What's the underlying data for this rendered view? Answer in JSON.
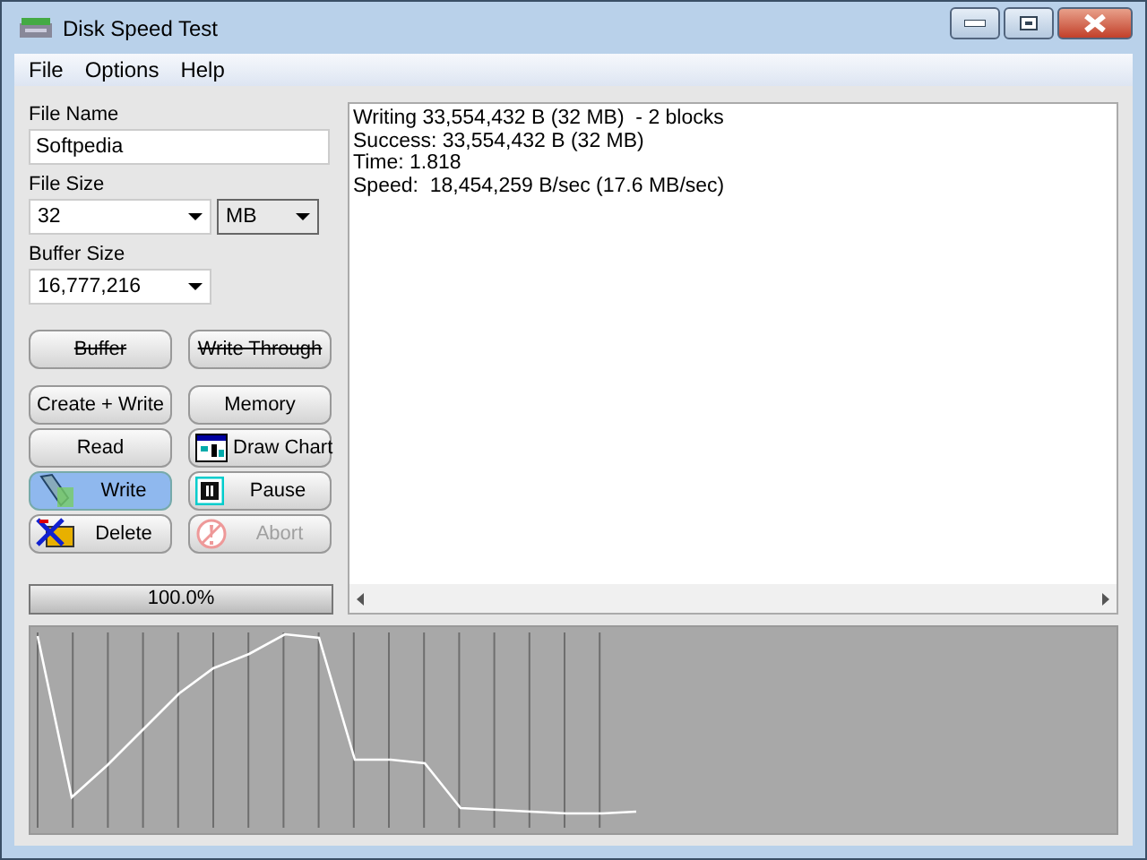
{
  "window": {
    "title": "Disk Speed Test"
  },
  "menu": [
    "File",
    "Options",
    "Help"
  ],
  "file_name": {
    "label": "File Name",
    "value": "Softpedia"
  },
  "file_size": {
    "label": "File Size",
    "value": "32",
    "unit": "MB"
  },
  "buffer_size": {
    "label": "Buffer Size",
    "value": "16,777,216"
  },
  "toggle_buttons": [
    {
      "label": "Buffer",
      "struck": true
    },
    {
      "label": "Write Through",
      "struck": true
    }
  ],
  "buttons": [
    {
      "label": "Create + Write",
      "selected": false,
      "disabled": false
    },
    {
      "label": "Memory",
      "selected": false,
      "disabled": false
    },
    {
      "label": "Read",
      "selected": false,
      "disabled": false
    },
    {
      "label": "Draw Chart",
      "selected": false,
      "disabled": false
    },
    {
      "label": "Write",
      "selected": true,
      "disabled": false
    },
    {
      "label": "Pause",
      "selected": false,
      "disabled": false
    },
    {
      "label": "Delete",
      "selected": false,
      "disabled": false
    },
    {
      "label": "Abort",
      "selected": false,
      "disabled": true
    }
  ],
  "progress": {
    "level": 1,
    "text": "100.0%"
  },
  "log": [
    "Writing 33,554,432 B (32 MB)  - 2 blocks",
    "Success: 33,554,432 B (32 MB)",
    "Time: 1.818",
    "Speed:  18,454,259 B/sec (17.6 MB/sec)"
  ]
}
